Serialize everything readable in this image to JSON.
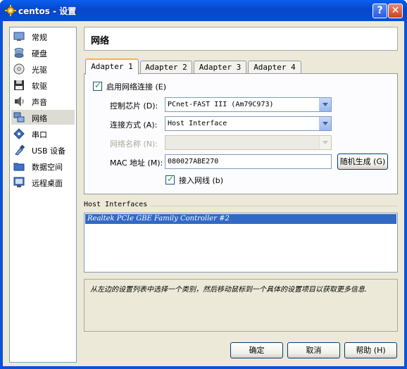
{
  "window": {
    "title": "centos - 设置",
    "help_label": "?",
    "close_label": "✕"
  },
  "sidebar": {
    "items": [
      {
        "label": "常规",
        "icon": "general-icon"
      },
      {
        "label": "硬盘",
        "icon": "hard-disk-icon"
      },
      {
        "label": "光驱",
        "icon": "cd-dvd-icon"
      },
      {
        "label": "软驱",
        "icon": "floppy-icon"
      },
      {
        "label": "声音",
        "icon": "audio-icon"
      },
      {
        "label": "网络",
        "icon": "network-icon",
        "selected": true
      },
      {
        "label": "串口",
        "icon": "serial-port-icon"
      },
      {
        "label": "USB 设备",
        "icon": "usb-icon"
      },
      {
        "label": "数据空间",
        "icon": "shared-folder-icon"
      },
      {
        "label": "远程桌面",
        "icon": "remote-display-icon"
      }
    ]
  },
  "header": {
    "title": "网络"
  },
  "tabs": [
    {
      "label": "Adapter 1",
      "active": true
    },
    {
      "label": "Adapter 2"
    },
    {
      "label": "Adapter 3"
    },
    {
      "label": "Adapter 4"
    }
  ],
  "adapter": {
    "enable_label": "启用网络连接 (E)",
    "enable_checked": true,
    "controller_label": "控制芯片 (D):",
    "controller_value": "PCnet-FAST III (Am79C973)",
    "attached_label": "连接方式 (A):",
    "attached_value": "Host Interface",
    "network_name_label": "网络名称 (N):",
    "network_name_value": "",
    "mac_label": "MAC 地址 (M):",
    "mac_value": "080027ABE270",
    "generate_label": "随机生成 (G)",
    "cable_label": "接入网线 (b)",
    "cable_checked": true
  },
  "host_interfaces": {
    "label": "Host Interfaces",
    "items": [
      "Realtek PCIe GBE Family Controller #2"
    ]
  },
  "info": {
    "text": "从左边的设置列表中选择一个类别，然后移动鼠标到一个具体的设置项目以获取更多信息."
  },
  "footer": {
    "ok_label": "确定",
    "cancel_label": "取消",
    "help_label": "帮助 (H)"
  },
  "colors": {
    "titlebar": "#0a53d8",
    "selection": "#316ac5",
    "dialog_bg": "#ece9d8",
    "tab_highlight": "#f3b640"
  }
}
